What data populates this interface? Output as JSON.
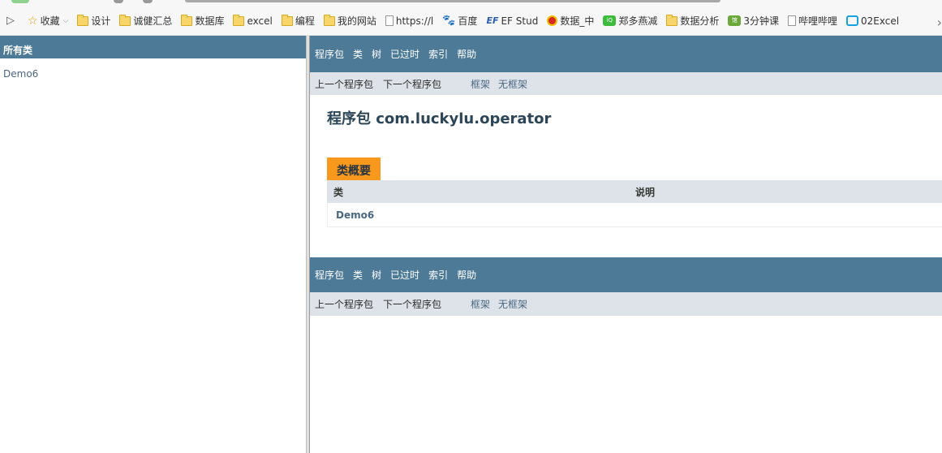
{
  "bookmarks": {
    "items": [
      {
        "label": "收藏",
        "icon": "star-icon"
      },
      {
        "label": "设计",
        "icon": "folder-icon"
      },
      {
        "label": "诚健汇总",
        "icon": "folder-icon"
      },
      {
        "label": "数据库",
        "icon": "folder-icon"
      },
      {
        "label": "excel",
        "icon": "folder-icon"
      },
      {
        "label": "编程",
        "icon": "folder-icon"
      },
      {
        "label": "我的网站",
        "icon": "folder-icon"
      },
      {
        "label": "https://l",
        "icon": "page-icon"
      },
      {
        "label": "百度",
        "icon": "baidu-paw-icon"
      },
      {
        "label": "EF Stud",
        "icon": "ef-icon"
      },
      {
        "label": "数据_中",
        "icon": "emblem-icon"
      },
      {
        "label": "郑多燕减",
        "icon": "iqiyi-icon"
      },
      {
        "label": "数据分析",
        "icon": "folder-icon"
      },
      {
        "label": "3分钟课",
        "icon": "green-square-icon"
      },
      {
        "label": "哔哩哔哩",
        "icon": "page-icon"
      },
      {
        "label": "02Excel",
        "icon": "bilibili-icon"
      }
    ]
  },
  "left": {
    "header": "所有类",
    "classes": [
      "Demo6"
    ]
  },
  "nav": {
    "package": "程序包",
    "class": "类",
    "tree": "树",
    "deprecated": "已过时",
    "index": "索引",
    "help": "帮助",
    "prev_package": "上一个程序包",
    "next_package": "下一个程序包",
    "frames": "框架",
    "no_frames": "无框架"
  },
  "main": {
    "title": "程序包 com.luckylu.operator",
    "summary": {
      "caption": "类概要",
      "col_class": "类",
      "col_desc": "说明",
      "rows": [
        {
          "name": "Demo6",
          "desc": ""
        }
      ]
    }
  },
  "colors": {
    "nav_bar": "#4d7a97",
    "sub_nav": "#dee3e9",
    "caption": "#f8981d",
    "link": "#4a6782"
  }
}
